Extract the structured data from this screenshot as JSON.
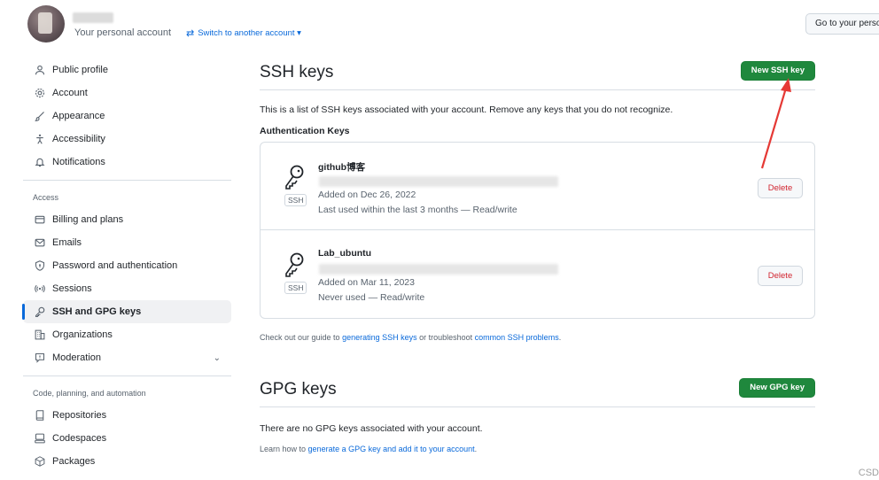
{
  "header": {
    "personal_account": "Your personal account",
    "switch_account": "Switch to another account ▾",
    "goto_button": "Go to your perso"
  },
  "sidebar": {
    "group1": [
      {
        "label": "Public profile",
        "icon": "person-icon"
      },
      {
        "label": "Account",
        "icon": "gear-icon"
      },
      {
        "label": "Appearance",
        "icon": "paintbrush-icon"
      },
      {
        "label": "Accessibility",
        "icon": "accessibility-icon"
      },
      {
        "label": "Notifications",
        "icon": "bell-icon"
      }
    ],
    "access_heading": "Access",
    "group2": [
      {
        "label": "Billing and plans",
        "icon": "credit-card-icon"
      },
      {
        "label": "Emails",
        "icon": "mail-icon"
      },
      {
        "label": "Password and authentication",
        "icon": "shield-lock-icon"
      },
      {
        "label": "Sessions",
        "icon": "broadcast-icon"
      },
      {
        "label": "SSH and GPG keys",
        "icon": "key-icon"
      },
      {
        "label": "Organizations",
        "icon": "organization-icon"
      },
      {
        "label": "Moderation",
        "icon": "report-icon"
      }
    ],
    "code_heading": "Code, planning, and automation",
    "group3": [
      {
        "label": "Repositories",
        "icon": "repo-icon"
      },
      {
        "label": "Codespaces",
        "icon": "codespaces-icon"
      },
      {
        "label": "Packages",
        "icon": "package-icon"
      }
    ]
  },
  "ssh": {
    "title": "SSH keys",
    "new_button": "New SSH key",
    "description": "This is a list of SSH keys associated with your account. Remove any keys that you do not recognize.",
    "auth_heading": "Authentication Keys",
    "badge": "SSH",
    "keys": [
      {
        "name": "github博客",
        "added": "Added on Dec 26, 2022",
        "used": "Last used within the last 3 months — Read/write",
        "delete": "Delete"
      },
      {
        "name": "Lab_ubuntu",
        "added": "Added on Mar 11, 2023",
        "used": "Never used — Read/write",
        "delete": "Delete"
      }
    ],
    "guide_prefix": "Check out our guide to ",
    "guide_link1": "generating SSH keys",
    "guide_mid": " or troubleshoot ",
    "guide_link2": "common SSH problems",
    "guide_suffix": "."
  },
  "gpg": {
    "title": "GPG keys",
    "new_button": "New GPG key",
    "empty": "There are no GPG keys associated with your account.",
    "learn_prefix": "Learn how to ",
    "learn_link": "generate a GPG key and add it to your account",
    "learn_suffix": "."
  },
  "watermark": "CSD",
  "colors": {
    "accent": "#0969da",
    "green": "#1f883d",
    "danger": "#d1242f",
    "arrow": "#e53935"
  }
}
